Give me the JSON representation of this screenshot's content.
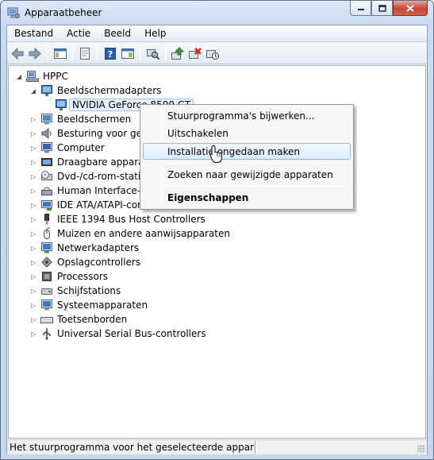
{
  "window": {
    "title": "Apparaatbeheer"
  },
  "menubar": {
    "items": [
      "Bestand",
      "Actie",
      "Beeld",
      "Help"
    ]
  },
  "toolbar": {
    "icons": [
      "back-arrow-icon",
      "forward-arrow-icon",
      "show-hide-console-tree-icon",
      "properties-icon",
      "help-icon",
      "show-action-pane-icon",
      "scan-hardware-icon",
      "update-driver-icon",
      "uninstall-icon",
      "disable-icon"
    ]
  },
  "tree": {
    "root": "HPPC",
    "items": [
      "Beeldschermadapters",
      "NVIDIA GeForce 8500 GT",
      "Beeldschermen",
      "Besturing voor geluid, video en spelletjes",
      "Computer",
      "Draagbare apparaten",
      "Dvd-/cd-rom-stations",
      "Human Interface-apparaten",
      "IDE ATA/ATAPI-controllers",
      "IEEE 1394 Bus Host Controllers",
      "Muizen en andere aanwijsapparaten",
      "Netwerkadapters",
      "Opslagcontrollers",
      "Processors",
      "Schijfstations",
      "Systeemapparaten",
      "Toetsenborden",
      "Universal Serial Bus-controllers"
    ],
    "visible_labels": [
      "Beeldschermadapters",
      "NVIDIA GeForce 8500 GT",
      "Beeldschermen",
      "Besturing voor gelu",
      "Computer",
      "Draagbare apparate",
      "Dvd-/cd-rom-static",
      "Human Interface-ap",
      "IDE ATA/ATAPI-cor",
      "IEEE 1394 Bus Host Controllers",
      "Muizen en andere aanwijsapparaten",
      "Netwerkadapters",
      "Opslagcontrollers",
      "Processors",
      "Schijfstations",
      "Systeemapparaten",
      "Toetsenborden",
      "Universal Serial Bus-controllers"
    ]
  },
  "context_menu": {
    "items": [
      "Stuurprogramma's bijwerken...",
      "Uitschakelen",
      "Installatie ongedaan maken",
      "Zoeken naar gewijzigde apparaten",
      "Eigenschappen"
    ],
    "highlighted": "Installatie ongedaan maken"
  },
  "statusbar": {
    "text": "Het stuurprogramma voor het geselecteerde apparaat verwijderen."
  }
}
